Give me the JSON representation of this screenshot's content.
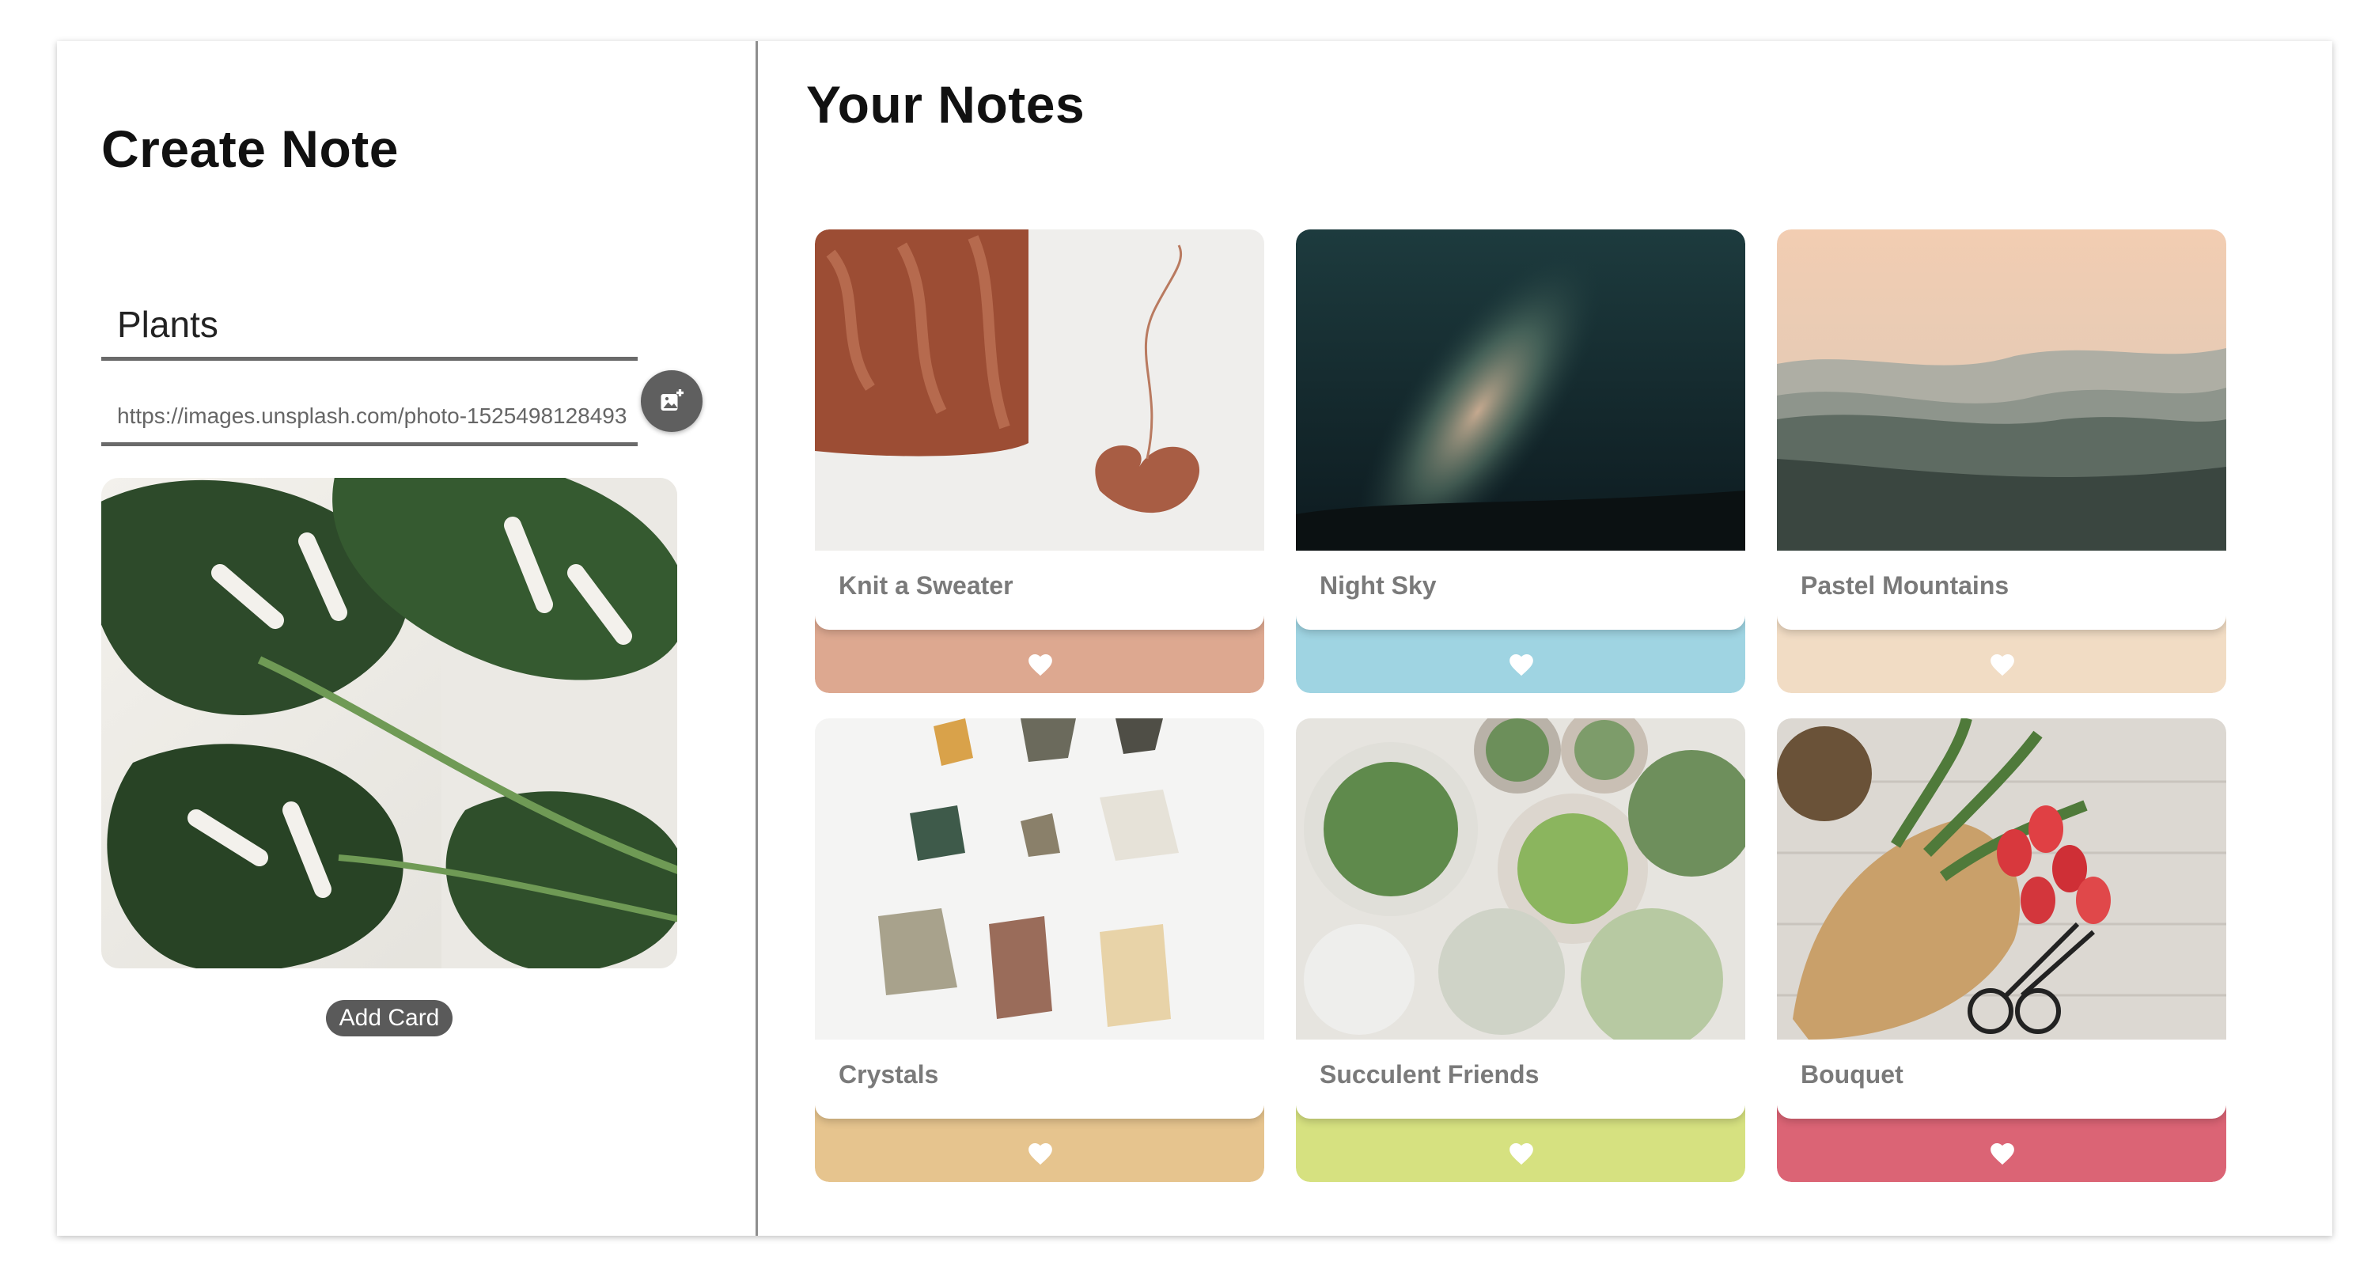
{
  "create_panel": {
    "title": "Create Note",
    "title_input_value": "Plants",
    "image_url_value": "https://images.unsplash.com/photo-1525498128493",
    "add_image_icon": "add-photo-icon",
    "add_card_label": "Add Card"
  },
  "notes_panel": {
    "title": "Your Notes",
    "notes": [
      {
        "label": "Knit a Sweater",
        "color": "#dda890"
      },
      {
        "label": "Night Sky",
        "color": "#9fd4e2"
      },
      {
        "label": "Pastel Mountains",
        "color": "#f1dcc4"
      },
      {
        "label": "Crystals",
        "color": "#e6c48e"
      },
      {
        "label": "Succulent Friends",
        "color": "#d6e180"
      },
      {
        "label": "Bouquet",
        "color": "#db6475"
      }
    ],
    "like_icon": "heart-icon"
  }
}
